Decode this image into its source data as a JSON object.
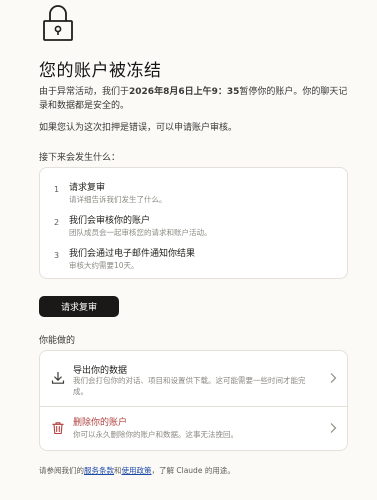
{
  "header": {
    "title": "您的账户被冻结"
  },
  "intro": {
    "prefix": "由于异常活动，我们于",
    "date": "2026年8月6日上午9：35",
    "suffix": "暂停你的账户。你的聊天记录和数据都是安全的。",
    "appeal_note": "如果您认为这次扣押是错误，可以申请账户审核。"
  },
  "next_steps": {
    "heading": "接下来会发生什么：",
    "items": [
      {
        "num": "1",
        "title": "请求复审",
        "desc": "请详细告诉我们发生了什么。"
      },
      {
        "num": "2",
        "title": "我们会审核你的账户",
        "desc": "团队成员会一起审核您的请求和账户活动。"
      },
      {
        "num": "3",
        "title": "我们会通过电子邮件通知你结果",
        "desc": "审核大约需要10天。"
      }
    ]
  },
  "primary_button": {
    "label": "请求复审"
  },
  "options": {
    "heading": "你能做的",
    "export": {
      "title": "导出你的数据",
      "desc": "我们会打包你的对话、项目和设置供下载。这可能需要一些时间才能完成。",
      "icon": "download-icon"
    },
    "delete": {
      "title": "删除你的账户",
      "desc": "你可以永久删除你的账户和数据。这事无法挽回。",
      "icon": "trash-icon",
      "color": "#b0413e"
    }
  },
  "footer": {
    "prefix": "请参阅我们的",
    "terms": "服务条款",
    "and": "和",
    "policy": "使用政策",
    "suffix": "，了解 Claude 的用途。"
  }
}
